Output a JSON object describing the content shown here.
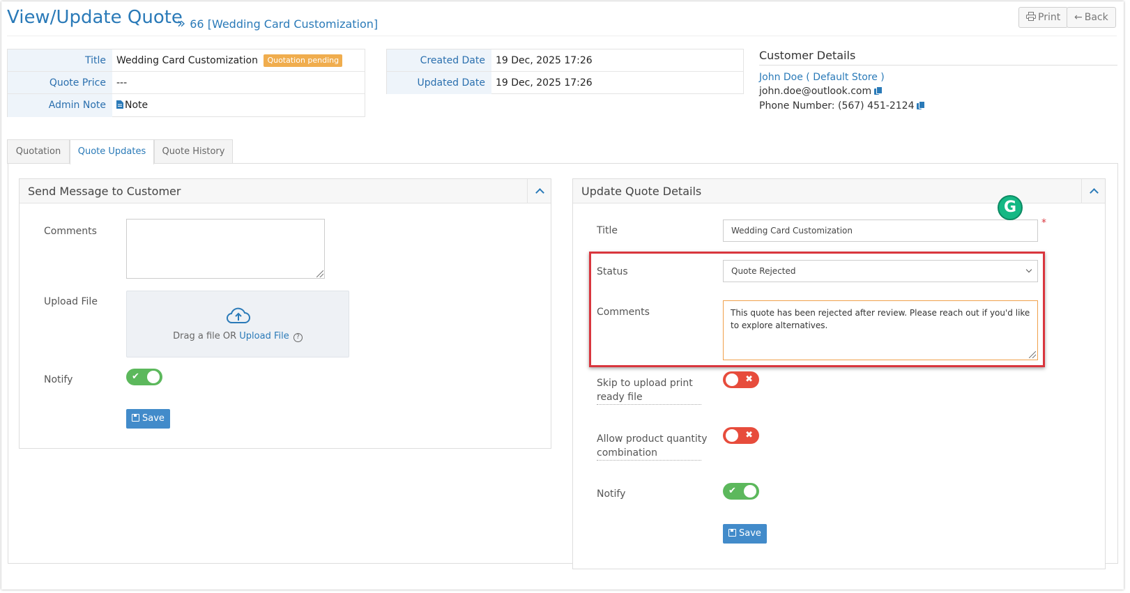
{
  "header": {
    "title": "View/Update Quote",
    "breadcrumb_chevron": "»",
    "breadcrumb": "66 [Wedding Card Customization]",
    "print_label": "Print",
    "back_label": "Back"
  },
  "quote_info": {
    "title_label": "Title",
    "title_value": "Wedding Card Customization",
    "status_badge": "Quotation pending",
    "price_label": "Quote Price",
    "price_value": "---",
    "admin_note_label": "Admin Note",
    "admin_note_link": "Note"
  },
  "dates": {
    "created_label": "Created Date",
    "created_value": "19 Dec, 2025 17:26",
    "updated_label": "Updated Date",
    "updated_value": "19 Dec, 2025 17:26"
  },
  "customer": {
    "heading": "Customer Details",
    "name": "John Doe ( Default Store )",
    "email": "john.doe@outlook.com",
    "phone": "Phone Number: (567) 451-2124"
  },
  "tabs": [
    {
      "label": "Quotation",
      "active": false
    },
    {
      "label": "Quote Updates",
      "active": true
    },
    {
      "label": "Quote History",
      "active": false
    }
  ],
  "message_panel": {
    "title": "Send Message to Customer",
    "comments_label": "Comments",
    "comments_value": "",
    "upload_label": "Upload File",
    "upload_text": "Drag a file OR",
    "upload_link": "Upload File",
    "notify_label": "Notify",
    "notify_on": true,
    "save_label": "Save"
  },
  "update_panel": {
    "title": "Update Quote Details",
    "title_label": "Title",
    "title_value": "Wedding Card Customization",
    "required_mark": "*",
    "status_label": "Status",
    "status_value": "Quote Rejected",
    "comments_label": "Comments",
    "comments_value": "This quote has been rejected after review. Please reach out if you'd like to explore alternatives.",
    "skip_upload_label": "Skip to upload print ready file",
    "skip_upload_on": false,
    "allow_qty_label": "Allow product quantity combination",
    "allow_qty_on": false,
    "notify_label": "Notify",
    "notify_on": true,
    "save_label": "Save"
  },
  "colors": {
    "accent": "#2a7ab8",
    "badge": "#f0ad4e",
    "toggle_on": "#5cb85c",
    "toggle_off": "#e74c3c",
    "highlight": "#d9363e",
    "grammarly": "#15b884"
  },
  "icons": {
    "print": "printer-icon",
    "back": "arrow-left-icon",
    "note": "document-icon",
    "copy": "copy-icon",
    "upload": "cloud-upload-icon",
    "help": "question-circle-icon",
    "save": "floppy-disk-icon",
    "grammarly": "grammarly-icon"
  }
}
